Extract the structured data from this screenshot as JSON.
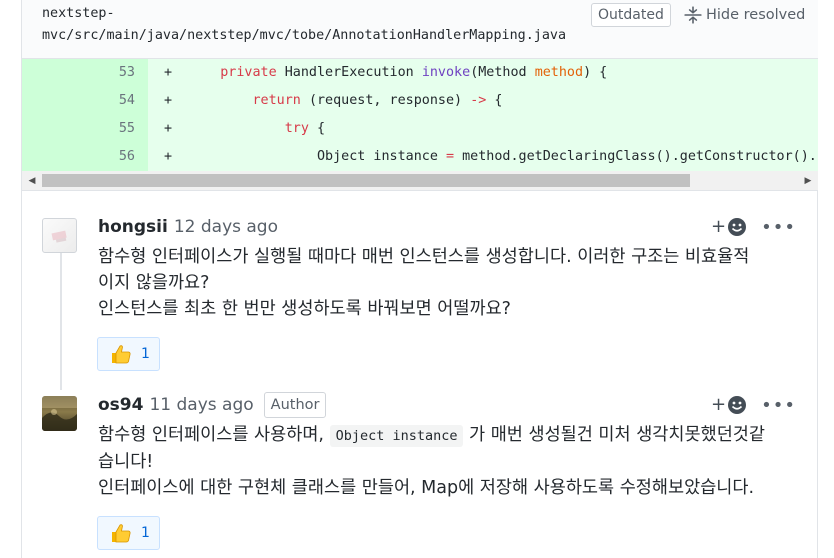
{
  "file": {
    "path": "nextstep-mvc/src/main/java/nextstep/mvc/tobe/AnnotationHandlerMapping.java",
    "outdated_label": "Outdated",
    "hide_resolved_label": "Hide resolved"
  },
  "code_lines": [
    {
      "num": "53",
      "sign": "+",
      "indent": "    ",
      "tokens": [
        {
          "t": "private ",
          "c": "kw"
        },
        {
          "t": "HandlerExecution ",
          "c": ""
        },
        {
          "t": "invoke",
          "c": "fn"
        },
        {
          "t": "(Method ",
          "c": ""
        },
        {
          "t": "method",
          "c": "pm"
        },
        {
          "t": ") {",
          "c": ""
        }
      ]
    },
    {
      "num": "54",
      "sign": "+",
      "indent": "        ",
      "tokens": [
        {
          "t": "return ",
          "c": "kw"
        },
        {
          "t": "(request, response) ",
          "c": ""
        },
        {
          "t": "->",
          "c": "kw"
        },
        {
          "t": " {",
          "c": ""
        }
      ]
    },
    {
      "num": "55",
      "sign": "+",
      "indent": "            ",
      "tokens": [
        {
          "t": "try",
          "c": "kw"
        },
        {
          "t": " {",
          "c": ""
        }
      ]
    },
    {
      "num": "56",
      "sign": "+",
      "indent": "                ",
      "tokens": [
        {
          "t": "Object instance ",
          "c": ""
        },
        {
          "t": "=",
          "c": "kw"
        },
        {
          "t": " method.getDeclaringClass().getConstructor().",
          "c": ""
        }
      ]
    }
  ],
  "comments": [
    {
      "author": "hongsii",
      "time": "12 days ago",
      "badge": "",
      "lines": [
        "함수형 인터페이스가 실행될 때마다 매번 인스턴스를 생성합니다. 이러한 구조는 비효율적",
        "이지 않을까요?",
        "인스턴스를 최초 한 번만 생성하도록 바꿔보면 어떨까요?"
      ],
      "reaction": {
        "emoji": "thumbs-up",
        "count": "1"
      }
    },
    {
      "author": "os94",
      "time": "11 days ago",
      "badge": "Author",
      "line1_before": "함수형 인터페이스를 사용하며, ",
      "line1_code": "Object instance",
      "line1_after": " 가 매번 생성될건 미처 생각치못했던것같",
      "line2": "습니다!",
      "line3": "인터페이스에 대한 구현체 클래스를 만들어, Map에 저장해 사용하도록 수정해보았습니다.",
      "reaction": {
        "emoji": "thumbs-up",
        "count": "1"
      }
    }
  ],
  "icons": {
    "unfold": "unfold-icon",
    "add_reaction": "smiley-plus-icon",
    "more": "kebab-horizontal-icon",
    "thumbs_up": "thumbs-up-icon"
  },
  "colors": {
    "addition_bg": "#e6ffed",
    "addition_num_bg": "#cdffd8",
    "link_blue": "#0366d6",
    "keyword_red": "#d73a49",
    "function_purple": "#6f42c1",
    "param_orange": "#e36209"
  }
}
